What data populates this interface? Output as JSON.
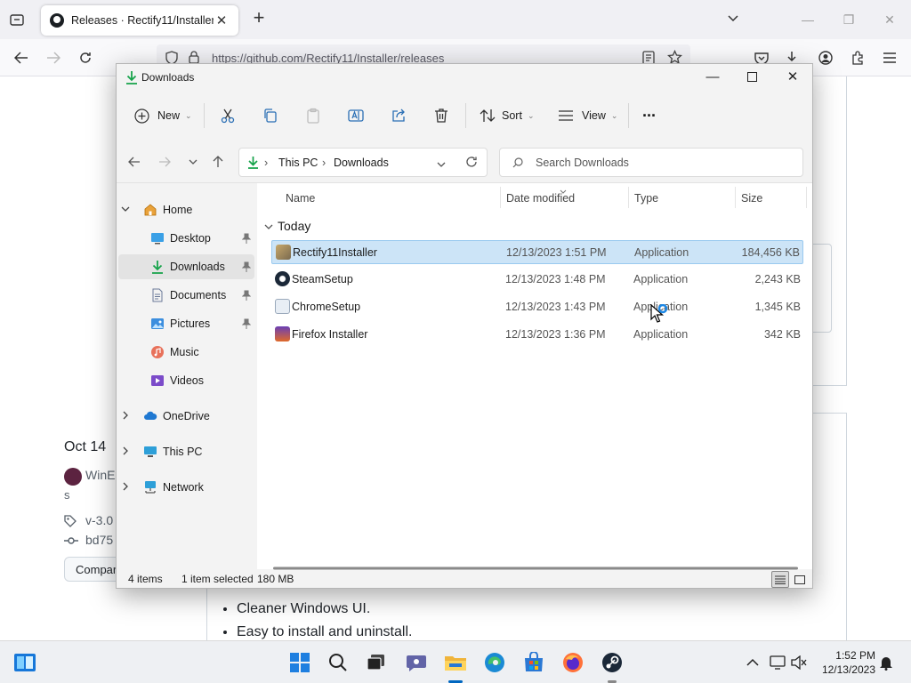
{
  "browser": {
    "tab_title": "Releases · Rectify11/Installer",
    "url": "https://github.com/Rectify11/Installer/releases"
  },
  "github": {
    "release_date": "Oct 14",
    "author": "WinEx",
    "author_line2": "s",
    "tag": "v-3.0",
    "commit": "bd75",
    "compare_label": "Compar",
    "bullets": [
      "Cleaner Windows UI.",
      "Easy to install and uninstall."
    ]
  },
  "explorer": {
    "window_title": "Downloads",
    "toolbar": {
      "new_label": "New",
      "sort_label": "Sort",
      "view_label": "View",
      "more_label": "···"
    },
    "breadcrumb": [
      "This PC",
      "Downloads"
    ],
    "search_placeholder": "Search Downloads",
    "sidebar": {
      "home": "Home",
      "quick_access": [
        {
          "label": "Desktop",
          "icon": "desktop-icon",
          "pinned": true
        },
        {
          "label": "Downloads",
          "icon": "downloads-icon",
          "pinned": true
        },
        {
          "label": "Documents",
          "icon": "documents-icon",
          "pinned": true
        },
        {
          "label": "Pictures",
          "icon": "pictures-icon",
          "pinned": true
        },
        {
          "label": "Music",
          "icon": "music-icon",
          "pinned": false
        },
        {
          "label": "Videos",
          "icon": "videos-icon",
          "pinned": false
        }
      ],
      "onedrive": "OneDrive",
      "this_pc": "This PC",
      "network": "Network"
    },
    "columns": {
      "name": "Name",
      "date": "Date modified",
      "type": "Type",
      "size": "Size"
    },
    "group": "Today",
    "files": [
      {
        "name": "Rectify11Installer",
        "date": "12/13/2023 1:51 PM",
        "type": "Application",
        "size": "184,456 KB",
        "icon": "rectify11-app-icon",
        "selected": true
      },
      {
        "name": "SteamSetup",
        "date": "12/13/2023 1:48 PM",
        "type": "Application",
        "size": "2,243 KB",
        "icon": "steam-app-icon",
        "selected": false
      },
      {
        "name": "ChromeSetup",
        "date": "12/13/2023 1:43 PM",
        "type": "Application",
        "size": "1,345 KB",
        "icon": "chrome-app-icon",
        "selected": false
      },
      {
        "name": "Firefox Installer",
        "date": "12/13/2023 1:36 PM",
        "type": "Application",
        "size": "342 KB",
        "icon": "firefox-app-icon",
        "selected": false
      }
    ],
    "status": {
      "items": "4 items",
      "selected": "1 item selected",
      "size": "180 MB"
    }
  },
  "taskbar": {
    "time": "1:52 PM",
    "date": "12/13/2023"
  },
  "colors": {
    "accent": "#0067c0",
    "selection_bg": "#cce4f7",
    "selection_border": "#99c9ef",
    "download_arrow": "#16a34a"
  }
}
